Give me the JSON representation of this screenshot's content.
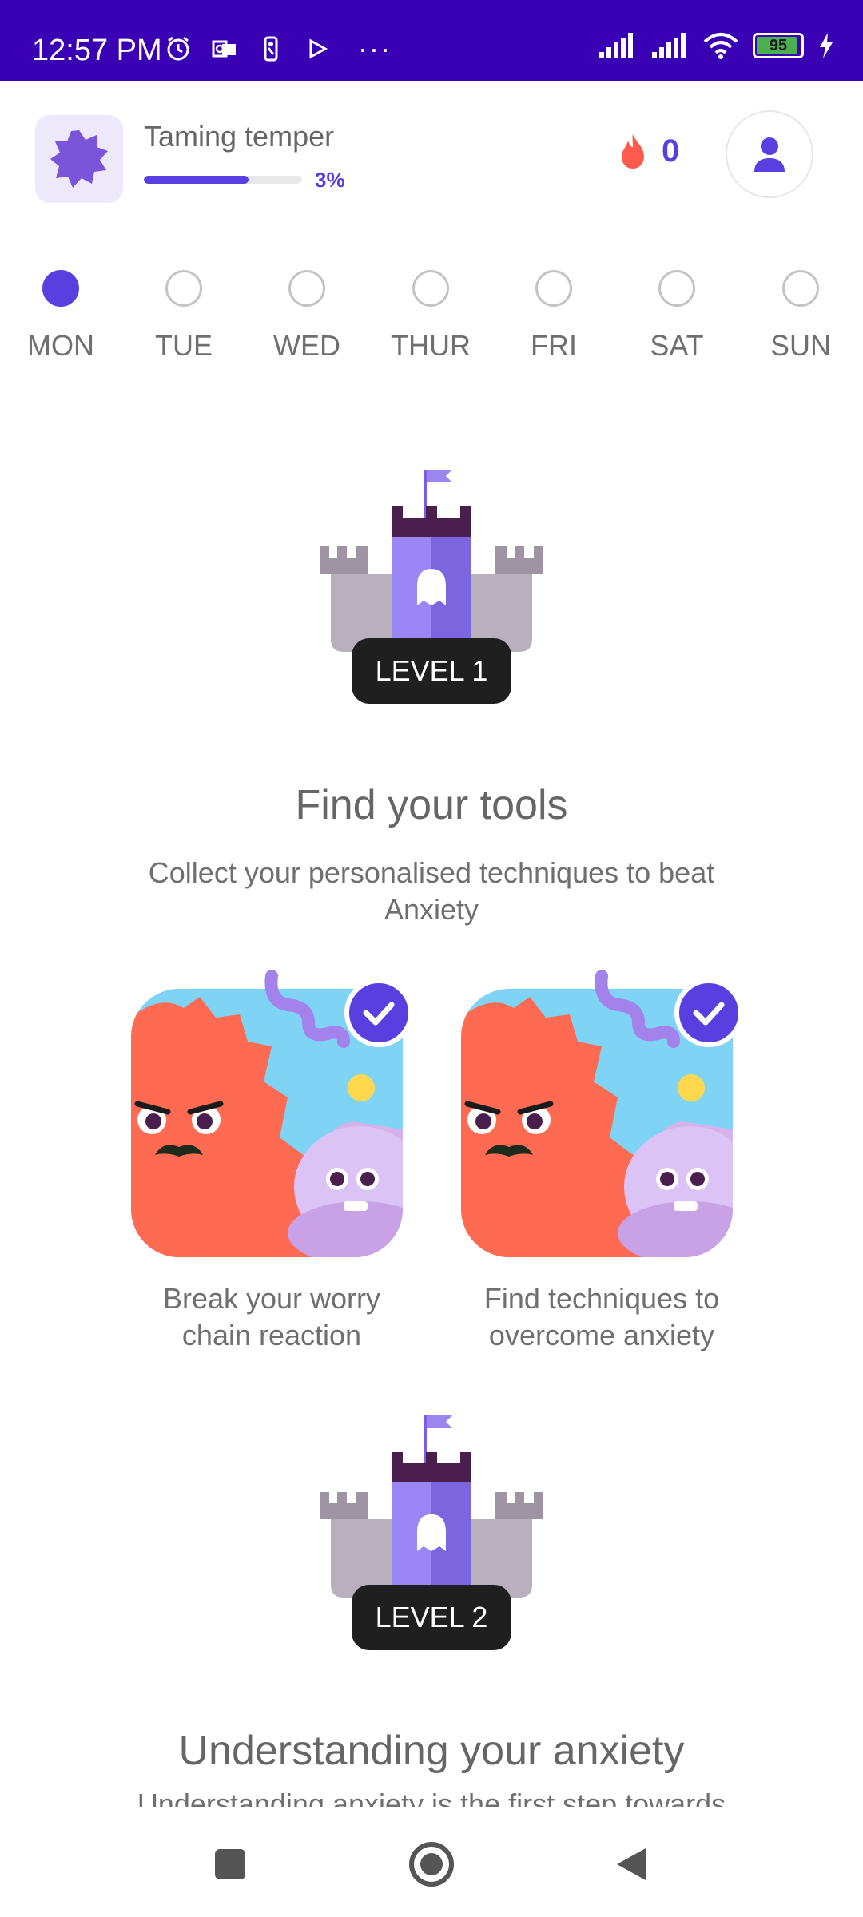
{
  "status_bar": {
    "time": "12:57 PM",
    "battery": "95",
    "icons": [
      "alarm-icon",
      "outlook-icon",
      "nba-icon",
      "play-icon",
      "more-icon",
      "signal-icon",
      "signal-icon",
      "wifi-icon",
      "battery-icon",
      "charging-icon"
    ],
    "more": "···"
  },
  "header": {
    "course_title": "Taming temper",
    "progress_percent": 3,
    "progress_label": "3%",
    "streak_count": "0",
    "accent_color": "#5a3fe0"
  },
  "week": {
    "days": [
      {
        "label": "MON",
        "active": true
      },
      {
        "label": "TUE",
        "active": false
      },
      {
        "label": "WED",
        "active": false
      },
      {
        "label": "THUR",
        "active": false
      },
      {
        "label": "FRI",
        "active": false
      },
      {
        "label": "SAT",
        "active": false
      },
      {
        "label": "SUN",
        "active": false
      }
    ]
  },
  "levels": [
    {
      "level_label": "LEVEL 1",
      "title": "Find your tools",
      "subtitle": "Collect your personalised techniques to beat Anxiety",
      "cards": [
        {
          "label": "Break your worry chain reaction",
          "completed": true
        },
        {
          "label": "Find techniques to overcome anxiety",
          "completed": true
        }
      ]
    },
    {
      "level_label": "LEVEL 2",
      "title": "Understanding your anxiety",
      "subtitle": "Understanding anxiety is the first step towards"
    }
  ],
  "nav": {
    "buttons": [
      "recents-icon",
      "home-icon",
      "back-icon"
    ]
  }
}
